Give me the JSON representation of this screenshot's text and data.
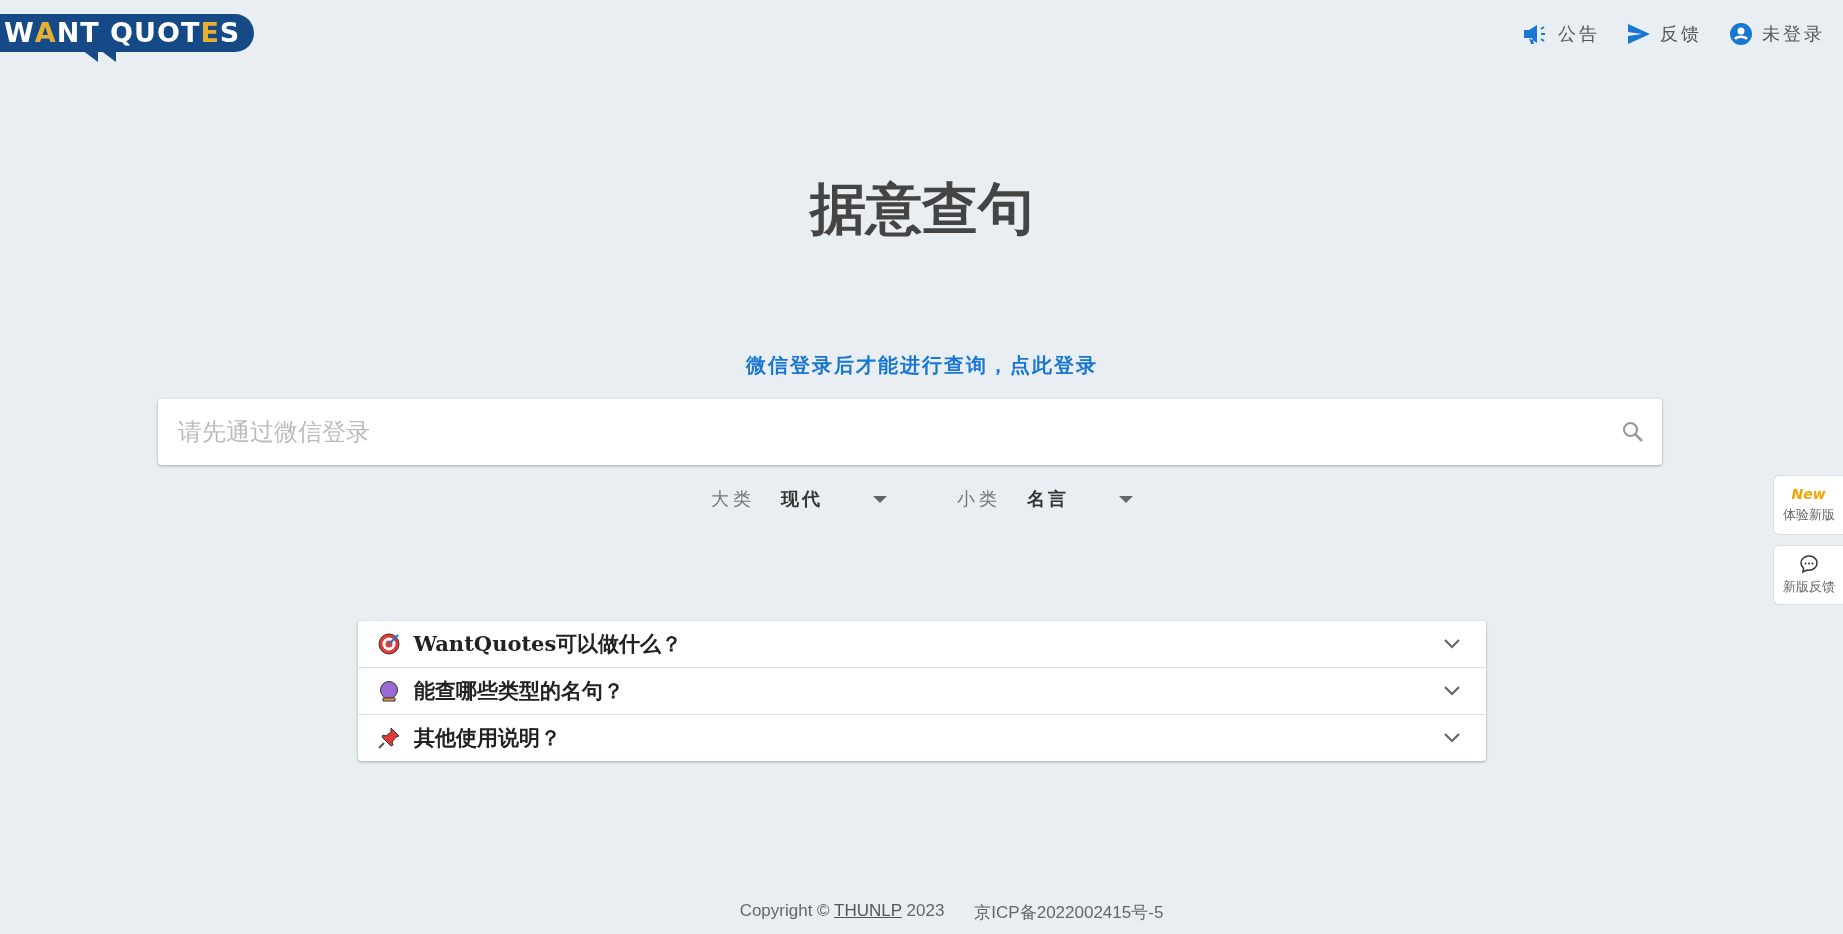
{
  "logo": {
    "segments": [
      {
        "text": "W",
        "accent": false
      },
      {
        "text": "A",
        "accent": true
      },
      {
        "text": "NT QUOT",
        "accent": false
      },
      {
        "text": "E",
        "accent": true
      },
      {
        "text": "S",
        "accent": false
      }
    ]
  },
  "nav": [
    {
      "kind": "announce",
      "label": "公告"
    },
    {
      "kind": "feedback",
      "label": "反馈"
    },
    {
      "kind": "account",
      "label": "未登录"
    }
  ],
  "title": "据意查句",
  "login_prompt": "微信登录后才能进行查询，点此登录",
  "search": {
    "placeholder": "请先通过微信登录"
  },
  "filters": [
    {
      "label": "大类",
      "value": "现代"
    },
    {
      "label": "小类",
      "value": "名言"
    }
  ],
  "side_buttons": [
    {
      "kind": "new",
      "badge": "New",
      "label": "体验新版"
    },
    {
      "kind": "chat",
      "label": "新版反馈"
    }
  ],
  "faq": [
    {
      "kind": "target",
      "question": "WantQuotes可以做什么？",
      "expanded": false
    },
    {
      "kind": "crystal",
      "question": "能查哪些类型的名句？",
      "expanded": false
    },
    {
      "kind": "pin",
      "question": "其他使用说明？",
      "expanded": false
    }
  ],
  "footer": {
    "copyright_prefix": "Copyright ©",
    "link": "THUNLP",
    "year": "2023",
    "icp": "京ICP备2022002415号-5"
  }
}
